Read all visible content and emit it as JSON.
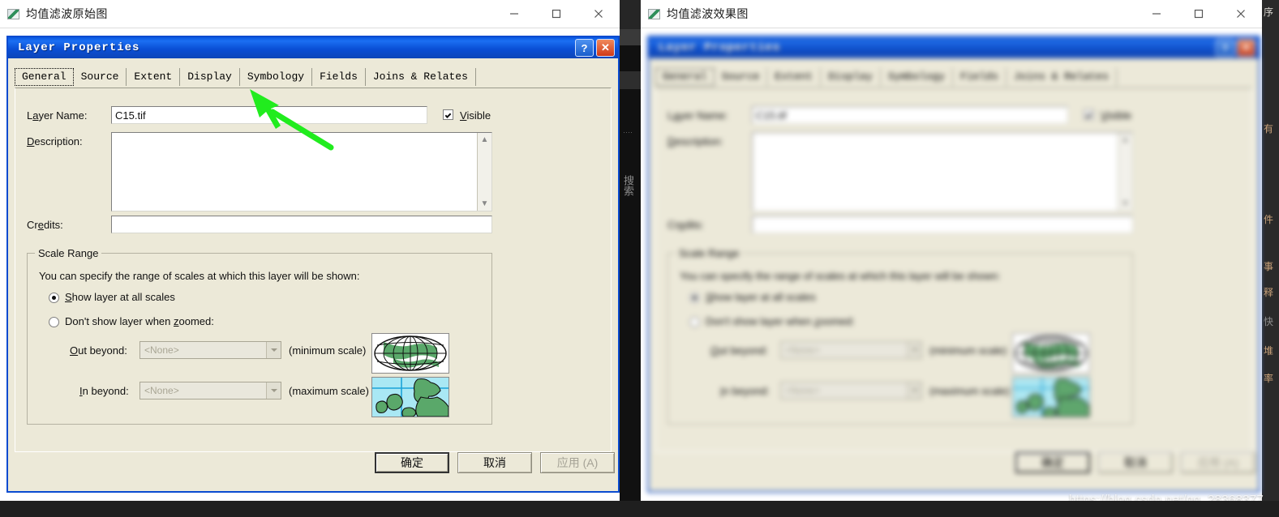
{
  "desktop": {
    "background": "#262626"
  },
  "windows": [
    {
      "id": "left",
      "title": "均值滤波原始图",
      "icon": "image-thumbnail-icon",
      "controls": {
        "minimize": "—",
        "maximize": "□",
        "close": "✕"
      }
    },
    {
      "id": "right",
      "title": "均值滤波效果图",
      "icon": "image-thumbnail-icon",
      "controls": {
        "minimize": "—",
        "maximize": "□",
        "close": "✕"
      }
    }
  ],
  "dialog": {
    "title": "Layer Properties",
    "titlebar_buttons": {
      "help": "?",
      "close": "✕"
    },
    "tabs": [
      {
        "label": "General",
        "active": true
      },
      {
        "label": "Source",
        "active": false
      },
      {
        "label": "Extent",
        "active": false
      },
      {
        "label": "Display",
        "active": false
      },
      {
        "label": "Symbology",
        "active": false
      },
      {
        "label": "Fields",
        "active": false
      },
      {
        "label": "Joins & Relates",
        "active": false
      }
    ],
    "fields": {
      "layer_name_label": "Layer Name:",
      "layer_name_value": "C15.tif",
      "visible_label": "Visible",
      "visible_checked": true,
      "description_label": "Description:",
      "description_value": "",
      "credits_label": "Credits:",
      "credits_value": ""
    },
    "scale_range": {
      "caption": "Scale Range",
      "hint": "You can specify the range of scales at which this layer will be shown:",
      "radio_all_scales": "Show layer at all scales",
      "radio_all_scales_selected": true,
      "radio_zoomed": "Don't show layer when zoomed:",
      "radio_zoomed_selected": false,
      "out_beyond_label": "Out beyond:",
      "out_beyond_value": "<None>",
      "out_beyond_suffix": "(minimum scale)",
      "in_beyond_label": "In beyond:",
      "in_beyond_value": "<None>",
      "in_beyond_suffix": "(maximum scale)",
      "globe_thumb": "globe-graticule-icon",
      "map_thumb": "europe-map-icon"
    },
    "buttons": {
      "ok": "确定",
      "cancel": "取消",
      "apply": "应用 (A)",
      "apply_disabled": true
    }
  },
  "annotations": [
    {
      "name": "green-arrow-left",
      "points_to": "Symbology",
      "color": "#21ec1e"
    },
    {
      "name": "green-arrow-right",
      "points_to": "Symbology",
      "color": "#21ec1e"
    }
  ],
  "background_panels": {
    "middle_sliver_text": "搜索",
    "right_edge_chars": [
      "有",
      "件",
      "事",
      "释",
      "快",
      "堆",
      "率"
    ]
  },
  "watermark": "https://blog.csdn.net/qq_28368377"
}
